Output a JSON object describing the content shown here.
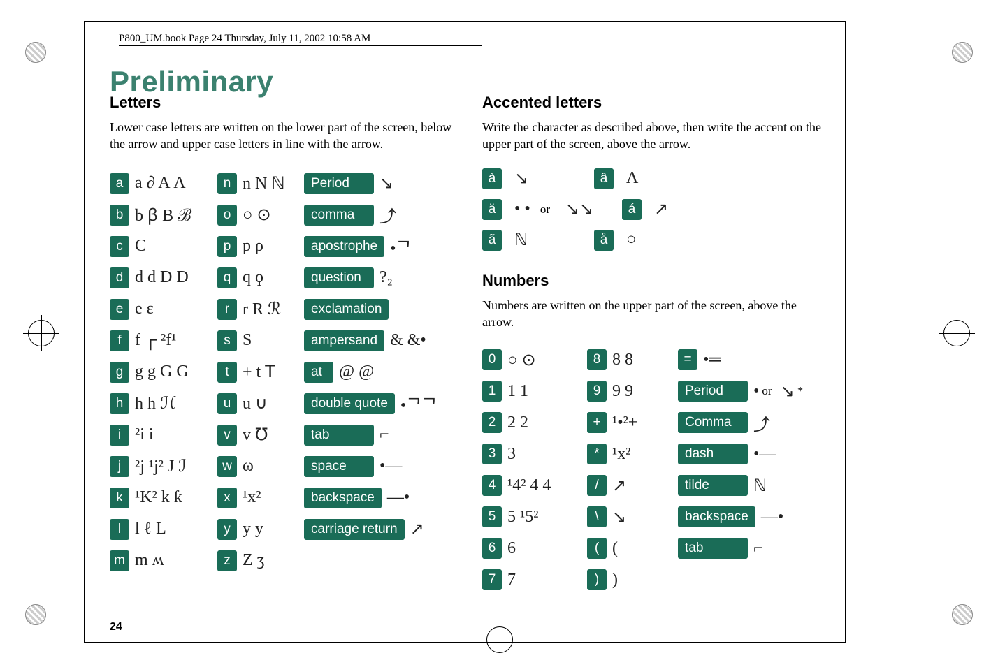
{
  "running_head": "P800_UM.book  Page 24  Thursday, July 11, 2002  10:58 AM",
  "watermark": "Preliminary",
  "page_number": "24",
  "letters": {
    "heading": "Letters",
    "body": "Lower case letters are written on the lower part of the screen, below the arrow and upper case letters in line with the arrow.",
    "colA": [
      "a",
      "b",
      "c",
      "d",
      "e",
      "f",
      "g",
      "h",
      "i",
      "j",
      "k",
      "l",
      "m"
    ],
    "colB": [
      "n",
      "o",
      "p",
      "q",
      "r",
      "s",
      "t",
      "u",
      "v",
      "w",
      "x",
      "y",
      "z"
    ],
    "colC": [
      "Period",
      "comma",
      "apostrophe",
      "question",
      "exclamation",
      "ampersand",
      "at",
      "double quote",
      "tab",
      "space",
      "backspace",
      "carriage return"
    ]
  },
  "accented": {
    "heading": "Accented letters",
    "body": "Write the character as described above, then write the accent on the upper part of the screen, above the arrow.",
    "items": [
      "à",
      "â",
      "ä",
      "á",
      "ã",
      "å"
    ],
    "or_label": "or"
  },
  "numbers": {
    "heading": "Numbers",
    "body": "Numbers are written on the upper part of the screen, above the arrow.",
    "colA": [
      "0",
      "1",
      "2",
      "3",
      "4",
      "5",
      "6",
      "7"
    ],
    "colB": [
      "8",
      "9",
      "+",
      "*",
      "/",
      "\\",
      "(",
      ")"
    ],
    "colC": [
      "=",
      "Period",
      "Comma",
      "dash",
      "tilde",
      "backspace",
      "tab"
    ],
    "period_suffix": "or",
    "period_trail": "*"
  }
}
